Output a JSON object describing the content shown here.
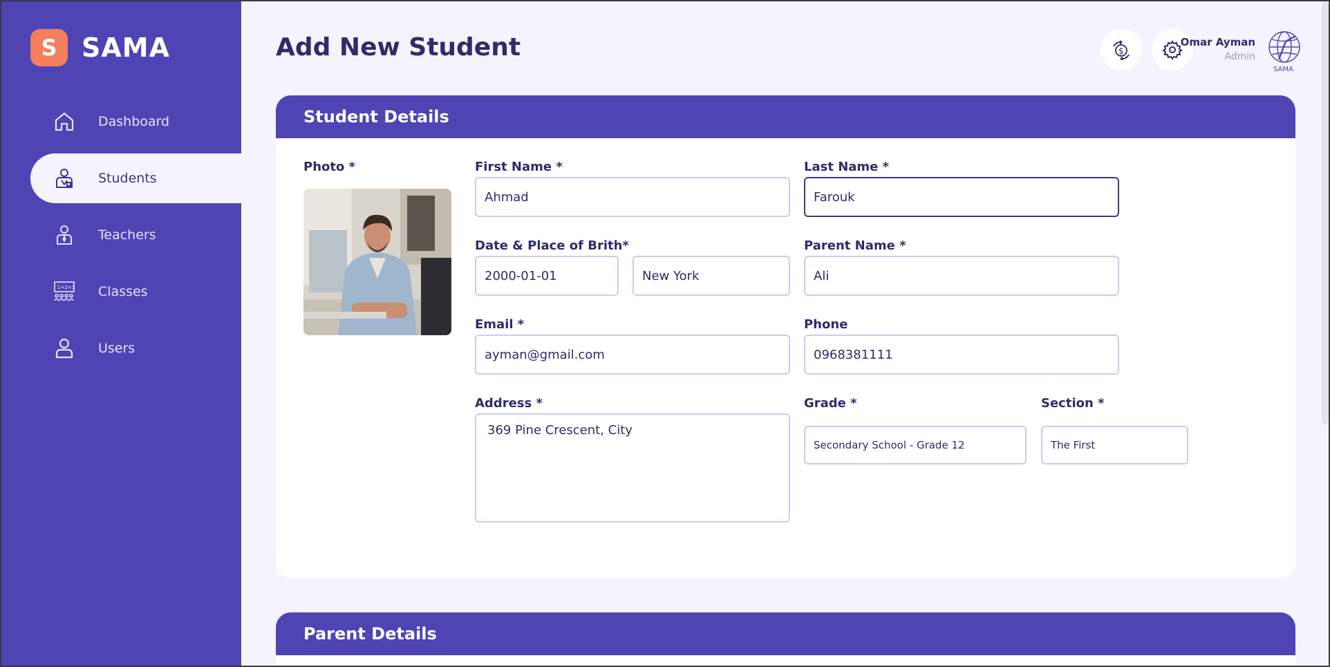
{
  "app": {
    "logo_letter": "S",
    "name": "SAMA"
  },
  "sidebar": {
    "items": [
      {
        "label": "Dashboard",
        "icon": "home-icon"
      },
      {
        "label": "Students",
        "icon": "student-icon",
        "active": true
      },
      {
        "label": "Teachers",
        "icon": "teacher-icon"
      },
      {
        "label": "Classes",
        "icon": "classroom-icon"
      },
      {
        "label": "Users",
        "icon": "user-icon"
      }
    ]
  },
  "header": {
    "title": "Add New Student",
    "user_name": "Omar Ayman",
    "user_role": "Admin",
    "user_logo_text": "SAMA"
  },
  "student_details": {
    "title": "Student Details",
    "photo_label": "Photo *",
    "first_name_label": "First Name *",
    "first_name_value": "Ahmad",
    "last_name_label": "Last Name *",
    "last_name_value": "Farouk",
    "birth_label": "Date & Place of Brith*",
    "birth_date_value": "2000-01-01",
    "birth_place_value": "New York",
    "parent_name_label": "Parent Name *",
    "parent_name_value": "Ali",
    "email_label": "Email *",
    "email_value": "ayman@gmail.com",
    "phone_label": "Phone",
    "phone_value": "0968381111",
    "address_label": "Address *",
    "address_value": "369 Pine Crescent, City",
    "grade_label": "Grade *",
    "grade_value": "Secondary School - Grade 12",
    "section_label": "Section *",
    "section_value": "The First"
  },
  "parent_details": {
    "title": "Parent Details"
  },
  "colors": {
    "primary": "#4e44b4",
    "accent": "#f47f5c",
    "background": "#f4f4fe",
    "text": "#2e2c6a"
  }
}
